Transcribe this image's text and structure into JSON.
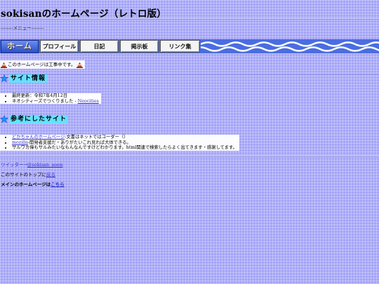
{
  "site": {
    "title": "sokisanのホームページ（レトロ版）"
  },
  "menu": {
    "label": "--------メニュー--------",
    "home": "ホーム",
    "items": [
      "プロフィール",
      "日記",
      "掲示板",
      "リンク集"
    ]
  },
  "notice": "このホームページは工事中です。",
  "site_info": {
    "heading": "サイト情報",
    "items": [
      {
        "text": "最終更新：令和7年4月12日",
        "link": ""
      },
      {
        "text": "ネオシティーズでつくりました - ",
        "link": "Neocities"
      }
    ]
  },
  "references": {
    "heading": "参考にしたサイト",
    "items": [
      {
        "link": "どかちゃんのホームページ",
        "text": "-文書はネットではコーダー（）"
      },
      {
        "link": "mozilla",
        "text": "-開発者支援だ・ありがたいこれ見れば大体できる。"
      },
      {
        "link": "",
        "text": "サルワカ偉もサルみたいなもんなんですけどわかります。html関連で検索したらよく出てきます・感謝してます。"
      }
    ]
  },
  "footer": {
    "twitter_prefix": "ツイッター→",
    "twitter_link": "@sokisan_aoon",
    "top_prefix": "このサイトのトップに",
    "top_link": "戻る",
    "main_prefix": "メインのホームページは",
    "main_link": "こちら"
  },
  "colors": {
    "background": "#a4a4f8",
    "menu_bar": "#4a6de0",
    "heading_highlight": "#66e0ff",
    "star": "#1e90ff"
  }
}
